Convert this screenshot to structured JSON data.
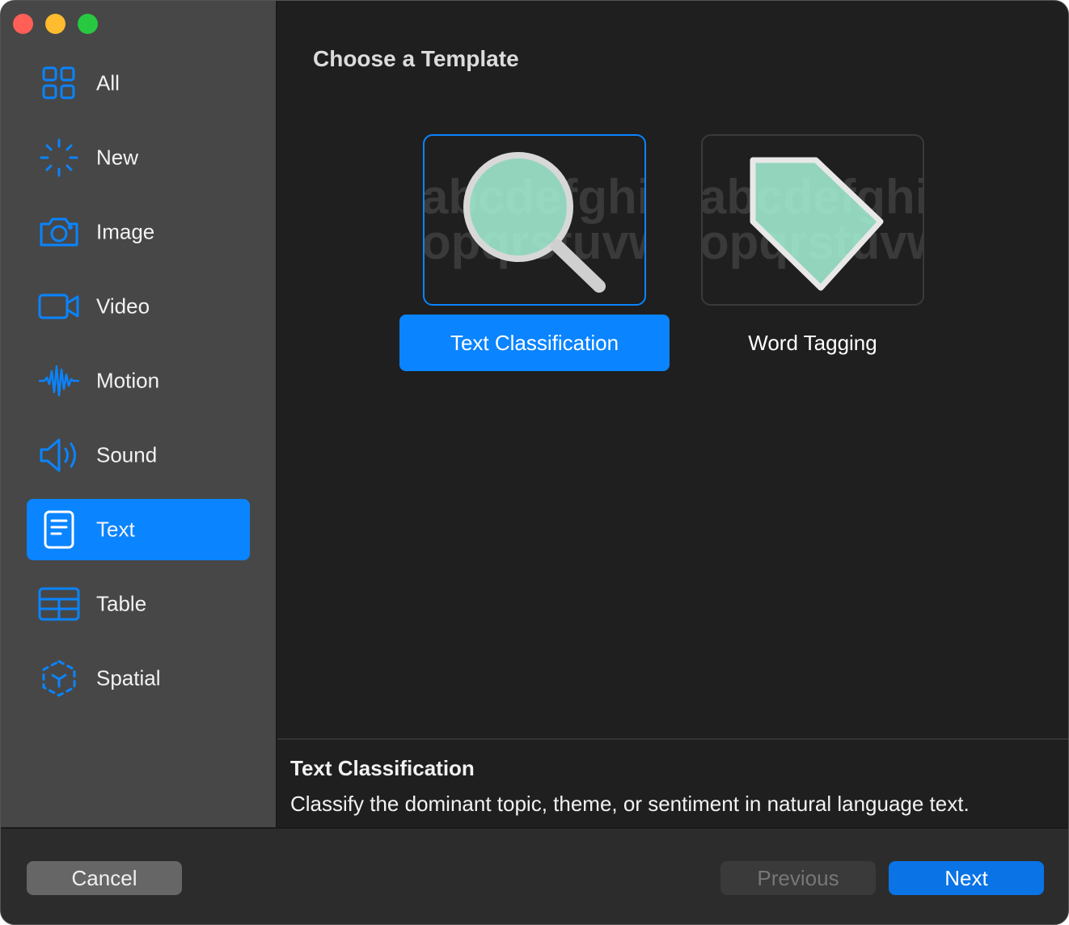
{
  "sidebar": {
    "items": [
      {
        "label": "All",
        "icon": "grid-icon",
        "selected": false
      },
      {
        "label": "New",
        "icon": "sparkle-icon",
        "selected": false
      },
      {
        "label": "Image",
        "icon": "camera-icon",
        "selected": false
      },
      {
        "label": "Video",
        "icon": "video-icon",
        "selected": false
      },
      {
        "label": "Motion",
        "icon": "waveform-icon",
        "selected": false
      },
      {
        "label": "Sound",
        "icon": "speaker-icon",
        "selected": false
      },
      {
        "label": "Text",
        "icon": "document-icon",
        "selected": true
      },
      {
        "label": "Table",
        "icon": "table-icon",
        "selected": false
      },
      {
        "label": "Spatial",
        "icon": "cube-icon",
        "selected": false
      }
    ]
  },
  "main": {
    "title": "Choose a Template",
    "templates": [
      {
        "label": "Text Classification",
        "icon": "magnifier-icon",
        "selected": true,
        "bg_text_1": "abcdefghi",
        "bg_text_2": "opqrstuvw"
      },
      {
        "label": "Word Tagging",
        "icon": "tag-icon",
        "selected": false,
        "bg_text_1": "abcdefghi",
        "bg_text_2": "opqrstuvw"
      }
    ]
  },
  "info": {
    "title": "Text Classification",
    "description": "Classify the dominant topic, theme, or sentiment in natural language text."
  },
  "footer": {
    "cancel_label": "Cancel",
    "previous_label": "Previous",
    "next_label": "Next"
  },
  "colors": {
    "accent": "#0a84ff",
    "sidebar_bg": "#474747",
    "main_bg": "#1f1f1f",
    "icon_mint": "#a8f5d8"
  }
}
